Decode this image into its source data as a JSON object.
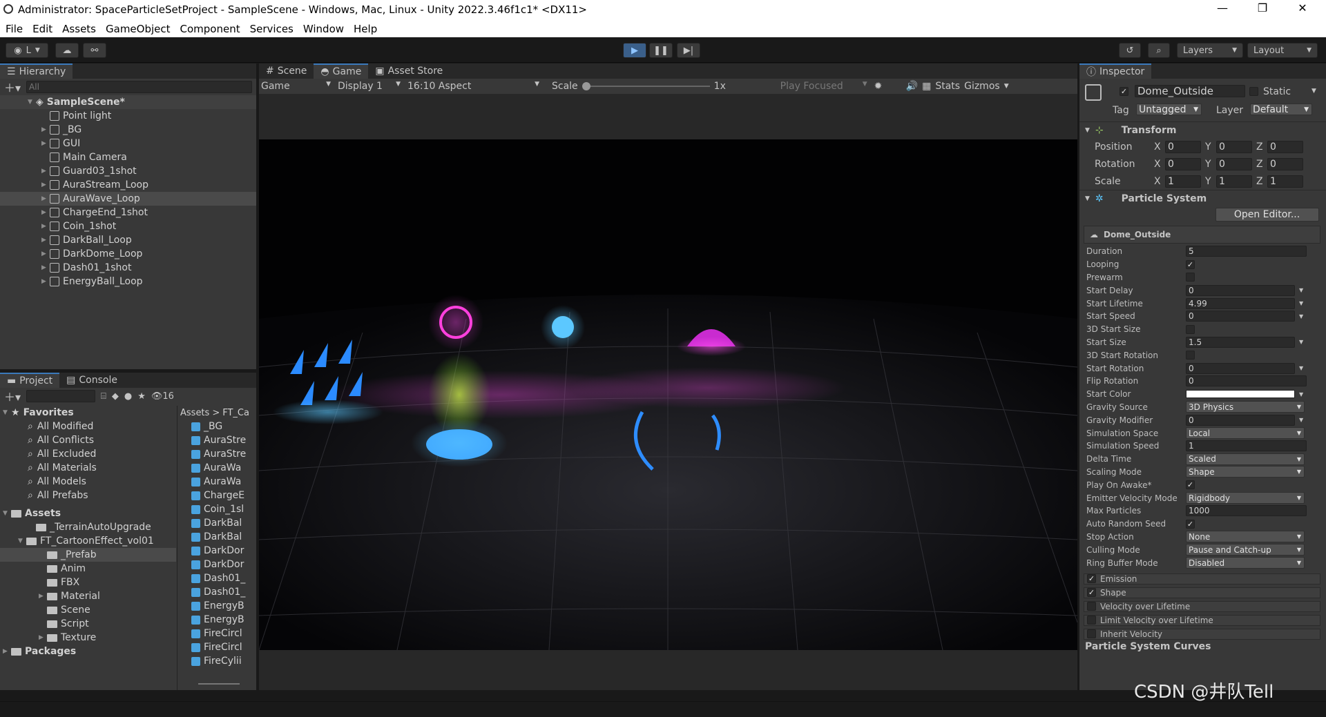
{
  "window": {
    "title": "Administrator: SpaceParticleSetProject - SampleScene - Windows, Mac, Linux - Unity 2022.3.46f1c1* <DX11>"
  },
  "menu": [
    "File",
    "Edit",
    "Assets",
    "GameObject",
    "Component",
    "Services",
    "Window",
    "Help"
  ],
  "toolbar": {
    "account_label": "L",
    "layers": "Layers",
    "layout": "Layout"
  },
  "hierarchy": {
    "tab": "Hierarchy",
    "search_placeholder": "All",
    "scene": "SampleScene*",
    "items": [
      "Point light",
      "_BG",
      "GUI",
      "Main Camera",
      "Guard03_1shot",
      "AuraStream_Loop",
      "AuraWave_Loop",
      "ChargeEnd_1shot",
      "Coin_1shot",
      "DarkBall_Loop",
      "DarkDome_Loop",
      "Dash01_1shot",
      "EnergyBall_Loop"
    ]
  },
  "project": {
    "tab_project": "Project",
    "tab_console": "Console",
    "hidden_count": "16",
    "favorites_label": "Favorites",
    "favorites": [
      "All Modified",
      "All Conflicts",
      "All Excluded",
      "All Materials",
      "All Models",
      "All Prefabs"
    ],
    "assets_label": "Assets",
    "tree": [
      "_TerrainAutoUpgrade",
      "FT_CartoonEffect_vol01",
      "_Prefab",
      "Anim",
      "FBX",
      "Material",
      "Scene",
      "Script",
      "Texture"
    ],
    "packages_label": "Packages",
    "breadcrumb_root": "Assets",
    "breadcrumb_child": "FT_Ca",
    "files": [
      "_BG",
      "AuraStre",
      "AuraStre",
      "AuraWa",
      "AuraWa",
      "ChargeE",
      "Coin_1sl",
      "DarkBal",
      "DarkBal",
      "DarkDor",
      "DarkDor",
      "Dash01_",
      "Dash01_",
      "EnergyB",
      "EnergyB",
      "FireCircl",
      "FireCircl",
      "FireCylii"
    ]
  },
  "center": {
    "tabs": [
      "Scene",
      "Game",
      "Asset Store"
    ],
    "game_mode": "Game",
    "display": "Display 1",
    "aspect": "16:10 Aspect",
    "scale_label": "Scale",
    "scale_value": "1x",
    "play_focused": "Play Focused",
    "stats": "Stats",
    "gizmos": "Gizmos"
  },
  "inspector": {
    "tab": "Inspector",
    "object_name": "Dome_Outside",
    "static": "Static",
    "tag_label": "Tag",
    "tag": "Untagged",
    "layer_label": "Layer",
    "layer": "Default",
    "transform_title": "Transform",
    "position": {
      "label": "Position",
      "x": "0",
      "y": "0",
      "z": "0"
    },
    "rotation": {
      "label": "Rotation",
      "x": "0",
      "y": "0",
      "z": "0"
    },
    "scale": {
      "label": "Scale",
      "x": "1",
      "y": "1",
      "z": "1"
    },
    "ps_title": "Particle System",
    "open_editor": "Open Editor...",
    "ps_name": "Dome_Outside",
    "props": [
      {
        "label": "Duration",
        "type": "field",
        "value": "5"
      },
      {
        "label": "Looping",
        "type": "check",
        "value": "✓"
      },
      {
        "label": "Prewarm",
        "type": "check",
        "value": ""
      },
      {
        "label": "Start Delay",
        "type": "fieldarrow",
        "value": "0"
      },
      {
        "label": "Start Lifetime",
        "type": "fieldarrow",
        "value": "4.99"
      },
      {
        "label": "Start Speed",
        "type": "fieldarrow",
        "value": "0"
      },
      {
        "label": "3D Start Size",
        "type": "check",
        "value": ""
      },
      {
        "label": "Start Size",
        "type": "fieldarrow",
        "value": "1.5"
      },
      {
        "label": "3D Start Rotation",
        "type": "check",
        "value": ""
      },
      {
        "label": "Start Rotation",
        "type": "fieldarrow",
        "value": "0"
      },
      {
        "label": "Flip Rotation",
        "type": "field",
        "value": "0"
      },
      {
        "label": "Start Color",
        "type": "color",
        "value": ""
      },
      {
        "label": "Gravity Source",
        "type": "drop",
        "value": "3D Physics"
      },
      {
        "label": "Gravity Modifier",
        "type": "fieldarrow",
        "value": "0"
      },
      {
        "label": "Simulation Space",
        "type": "drop",
        "value": "Local"
      },
      {
        "label": "Simulation Speed",
        "type": "field",
        "value": "1"
      },
      {
        "label": "Delta Time",
        "type": "drop",
        "value": "Scaled"
      },
      {
        "label": "Scaling Mode",
        "type": "drop",
        "value": "Shape"
      },
      {
        "label": "Play On Awake*",
        "type": "check",
        "value": "✓"
      },
      {
        "label": "Emitter Velocity Mode",
        "type": "drop",
        "value": "Rigidbody"
      },
      {
        "label": "Max Particles",
        "type": "field",
        "value": "1000"
      },
      {
        "label": "Auto Random Seed",
        "type": "check",
        "value": "✓"
      },
      {
        "label": "Stop Action",
        "type": "drop",
        "value": "None"
      },
      {
        "label": "Culling Mode",
        "type": "drop",
        "value": "Pause and Catch-up"
      },
      {
        "label": "Ring Buffer Mode",
        "type": "drop",
        "value": "Disabled"
      }
    ],
    "modules": [
      {
        "label": "Emission",
        "checked": "✓"
      },
      {
        "label": "Shape",
        "checked": "✓"
      },
      {
        "label": "Velocity over Lifetime",
        "checked": ""
      },
      {
        "label": "Limit Velocity over Lifetime",
        "checked": ""
      },
      {
        "label": "Inherit Velocity",
        "checked": ""
      }
    ],
    "curves": "Particle System Curves"
  },
  "watermark": "CSDN @井队Tell"
}
